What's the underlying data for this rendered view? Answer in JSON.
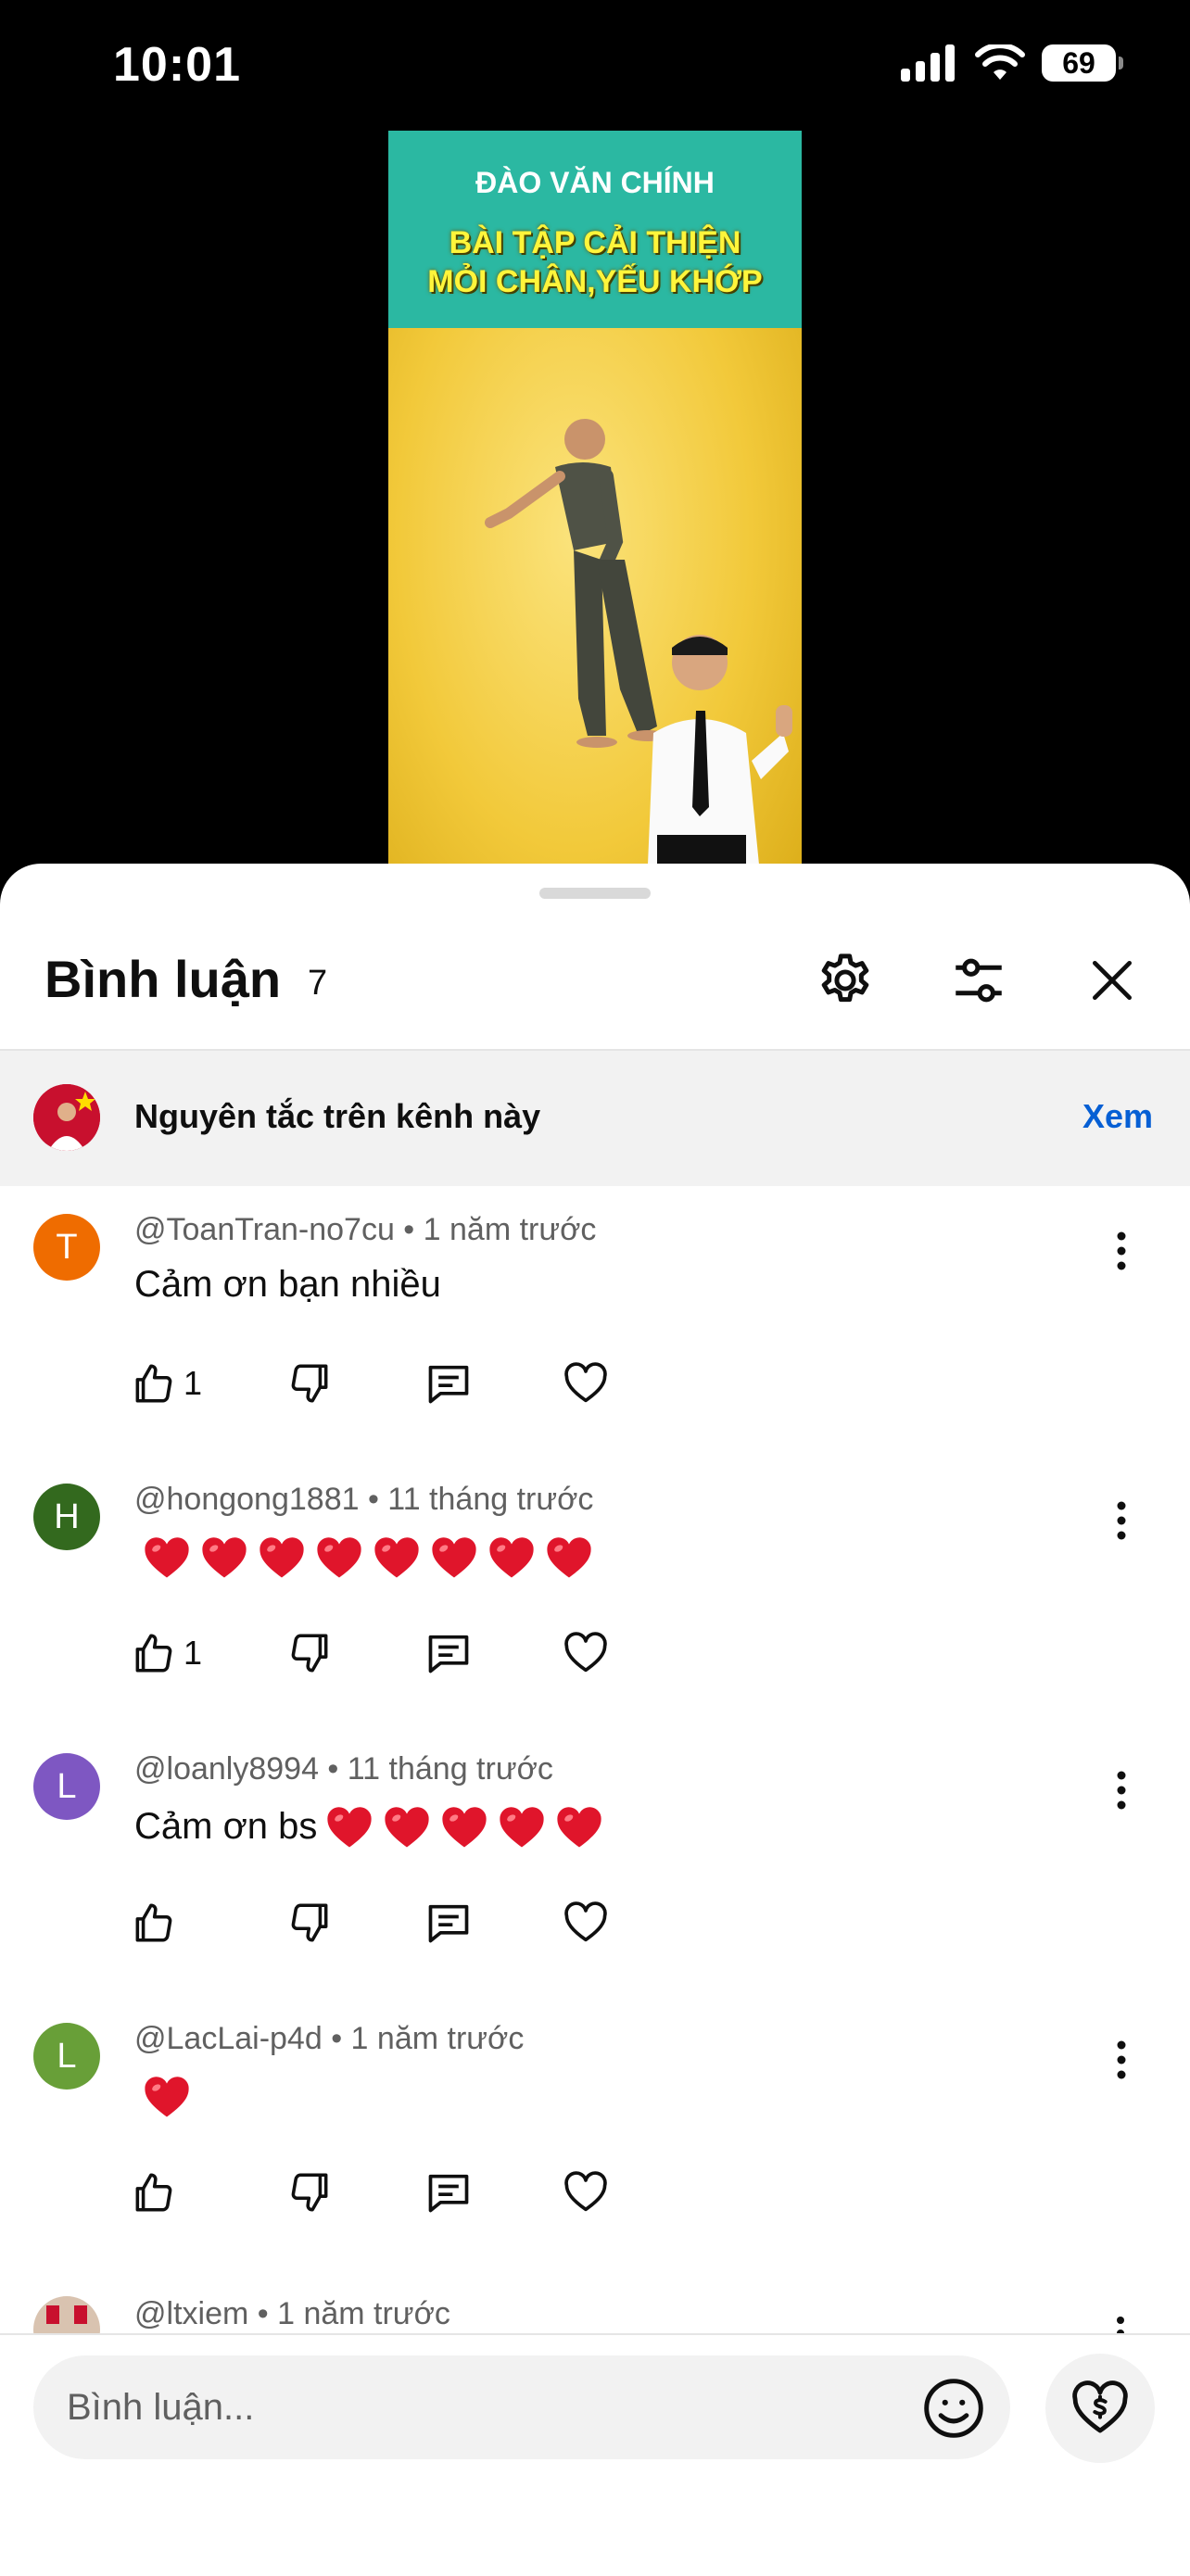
{
  "status_bar": {
    "time": "10:01",
    "battery": "69"
  },
  "video": {
    "channel_name": "ĐÀO VĂN CHÍNH",
    "title_line1": "BÀI TẬP CẢI THIỆN",
    "title_line2": "MỎI CHÂN,YẾU KHỚP"
  },
  "header": {
    "title": "Bình luận",
    "count": "7"
  },
  "guidelines": {
    "text": "Nguyên tắc trên kênh này",
    "link": "Xem"
  },
  "comments": [
    {
      "initial": "T",
      "avatar_color": "#ef6c00",
      "meta": "@ToanTran-no7cu • 1 năm trước",
      "text": "Cảm ơn bạn nhiều",
      "hearts": 0,
      "likes": "1"
    },
    {
      "initial": "H",
      "avatar_color": "#33691e",
      "meta": "@hongong1881 • 11 tháng trước",
      "text": "",
      "hearts": 8,
      "likes": "1"
    },
    {
      "initial": "L",
      "avatar_color": "#7e57c2",
      "meta": "@loanly8994 • 11 tháng trước",
      "text": "Cảm ơn bs",
      "hearts": 5,
      "likes": ""
    },
    {
      "initial": "L",
      "avatar_color": "#689f38",
      "meta": "@LacLai-p4d • 1 năm trước",
      "text": "",
      "hearts": 1,
      "likes": ""
    }
  ],
  "partial_comment": {
    "meta": "@ltxiem • 1 năm trước"
  },
  "input": {
    "placeholder": "Bình luận..."
  },
  "icons": {
    "settings": "gear-icon",
    "filter": "sliders-icon",
    "close": "close-icon",
    "like": "thumb-up-icon",
    "dislike": "thumb-down-icon",
    "reply": "reply-icon",
    "heart": "heart-icon",
    "more": "more-vert-icon",
    "emoji": "emoji-icon",
    "thanks": "super-thanks-icon"
  }
}
